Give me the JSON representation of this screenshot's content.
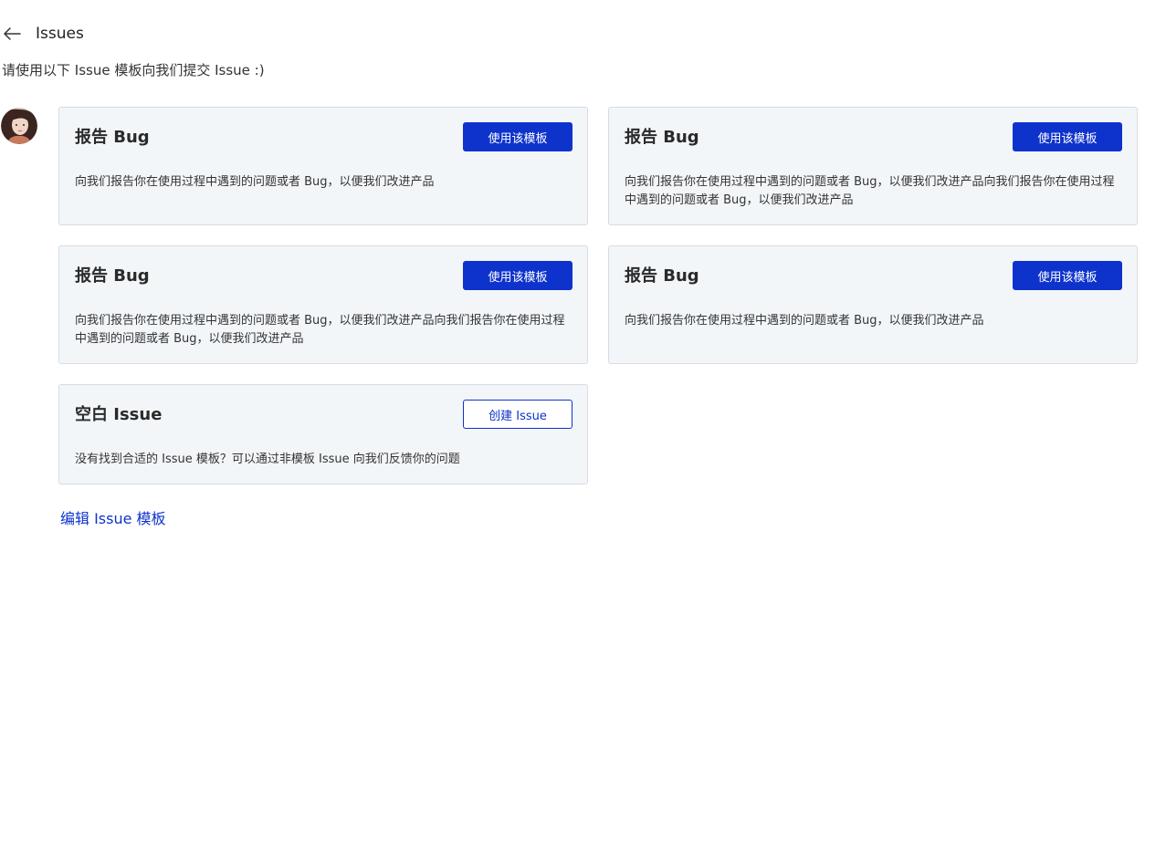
{
  "header": {
    "back_icon": "arrow-left-icon",
    "title": "Issues"
  },
  "subtitle": "请使用以下 Issue 模板向我们提交 Issue :)",
  "avatar": {
    "icon": "user-avatar"
  },
  "templates": [
    {
      "title": "报告 Bug",
      "button_label": "使用该模板",
      "description": "向我们报告你在使用过程中遇到的问题或者 Bug，以便我们改进产品"
    },
    {
      "title": "报告 Bug",
      "button_label": "使用该模板",
      "description": "向我们报告你在使用过程中遇到的问题或者 Bug，以便我们改进产品向我们报告你在使用过程中遇到的问题或者 Bug，以便我们改进产品"
    },
    {
      "title": "报告 Bug",
      "button_label": "使用该模板",
      "description": "向我们报告你在使用过程中遇到的问题或者 Bug，以便我们改进产品向我们报告你在使用过程中遇到的问题或者 Bug，以便我们改进产品"
    },
    {
      "title": "报告 Bug",
      "button_label": "使用该模板",
      "description": "向我们报告你在使用过程中遇到的问题或者 Bug，以便我们改进产品"
    }
  ],
  "blank": {
    "title": "空白 Issue",
    "button_label": "创建 Issue",
    "description": "没有找到合适的 Issue 模板？可以通过非模板 Issue 向我们反馈你的问题"
  },
  "edit_link": "编辑 Issue 模板",
  "colors": {
    "primary": "#0e33cc",
    "card_bg": "#f3f6f9",
    "card_border": "#d6dce3"
  }
}
